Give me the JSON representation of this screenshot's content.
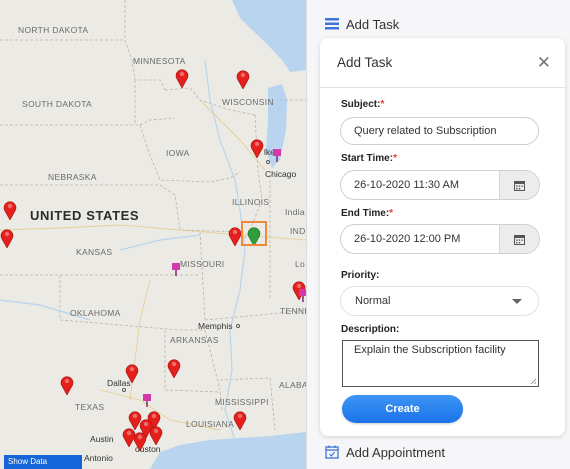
{
  "map": {
    "country_label": "UNITED STATES",
    "state_labels": {
      "north_dakota": "NORTH DAKOTA",
      "minnesota": "MINNESOTA",
      "south_dakota": "SOUTH DAKOTA",
      "wisconsin": "WISCONSIN",
      "iowa": "IOWA",
      "nebraska": "NEBRASKA",
      "illinois": "ILLINOIS",
      "indiana": "India",
      "ind2": "IND",
      "kansas": "KANSAS",
      "missouri": "MISSOURI",
      "oklahoma": "OKLAHOMA",
      "arkansas": "ARKANSAS",
      "tennessee": "TENNE",
      "texas": "TEXAS",
      "mississippi": "MISSISSIPPI",
      "louisiana": "LOUISIANA",
      "alabama": "ALABA",
      "lo": "Lo"
    },
    "city_labels": {
      "milwaukee": "lkee",
      "chicago": "Chicago",
      "memphis": "Memphis",
      "dallas": "Dallas",
      "austin": "Austin",
      "houston": "ouston",
      "san_antonio": "Antonio"
    },
    "show_button": "Show Data",
    "pin_colors": {
      "red": "#e5201c",
      "green": "#2e9e3c",
      "magenta": "#d13aa8"
    }
  },
  "panel": {
    "add_task_header": "Add Task",
    "add_appointment_header": "Add Appointment",
    "form": {
      "title": "Add Task",
      "subject_label": "Subject:",
      "subject_value": "Query related to Subscription",
      "start_label": "Start Time:",
      "start_value": "26-10-2020 11:30 AM",
      "end_label": "End Time:",
      "end_value": "26-10-2020 12:00 PM",
      "priority_label": "Priority:",
      "priority_value": "Normal",
      "description_label": "Description:",
      "description_value": "Explain the Subscription facility",
      "required_mark": "*",
      "create_label": "Create"
    },
    "accent_color": "#1b73e8"
  }
}
